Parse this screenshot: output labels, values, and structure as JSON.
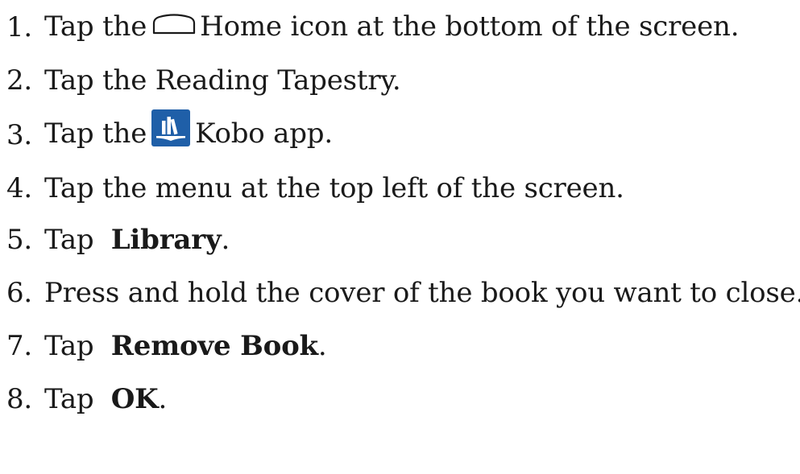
{
  "steps": [
    {
      "num": "1.",
      "before": "Tap the",
      "icon": "home-outline-icon",
      "after": "Home icon at the bottom of the screen."
    },
    {
      "num": "2.",
      "text": "Tap the Reading Tapestry."
    },
    {
      "num": "3.",
      "before": "Tap the",
      "icon": "kobo-app-icon",
      "after": "Kobo app."
    },
    {
      "num": "4.",
      "text": "Tap the menu at the top left of the screen."
    },
    {
      "num": "5.",
      "before": "Tap ",
      "bold": "Library",
      "after": "."
    },
    {
      "num": "6.",
      "text": "Press and hold the cover of the book you want to close."
    },
    {
      "num": "7.",
      "before": "Tap ",
      "bold": "Remove Book",
      "after": "."
    },
    {
      "num": "8.",
      "before": "Tap ",
      "bold": "OK",
      "after": "."
    }
  ],
  "colors": {
    "text": "#1a1a1a",
    "kobo_blue": "#1f5fa8"
  }
}
